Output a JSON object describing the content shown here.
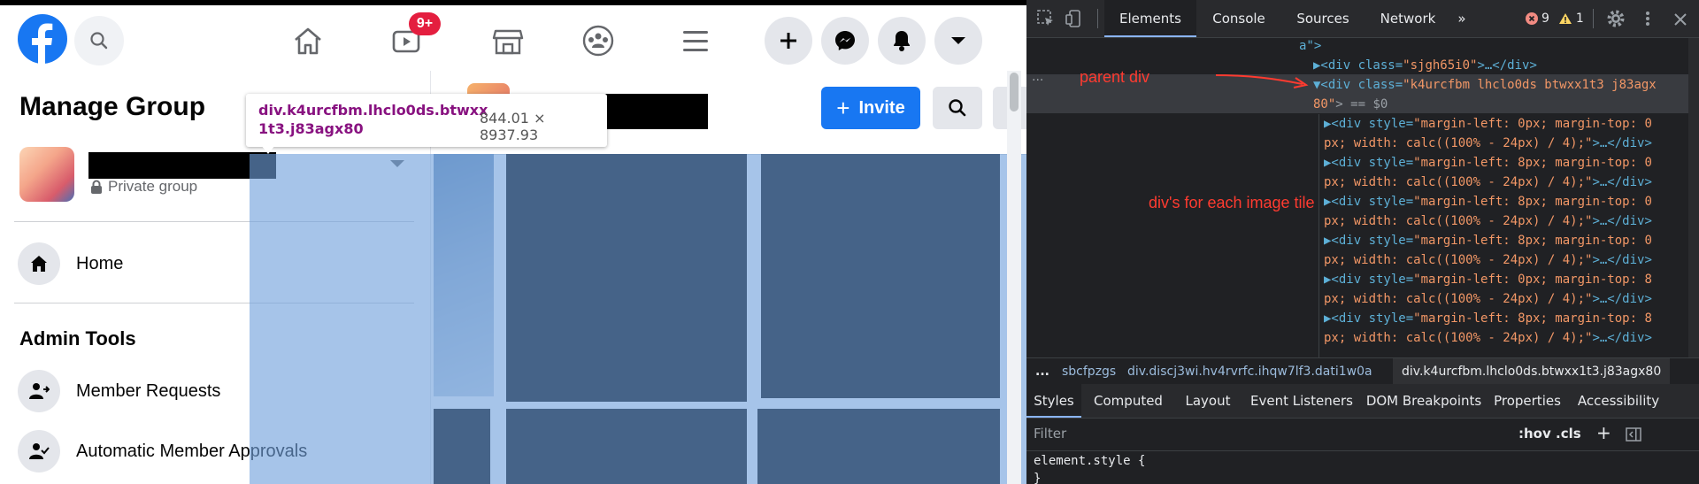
{
  "facebook": {
    "topbar": {
      "search_icon": "search-icon",
      "notifications_badge": "9+",
      "nav_icons": [
        "home-icon",
        "watch-icon",
        "marketplace-icon",
        "groups-icon",
        "menu-icon"
      ],
      "actions": [
        "create-icon",
        "messenger-icon",
        "notifications-icon",
        "account-dropdown-icon"
      ]
    },
    "sidebar": {
      "title": "Manage Group",
      "group_privacy": "Private group",
      "nav_home": "Home",
      "section_admin": "Admin Tools",
      "admin_items": [
        "Member Requests",
        "Automatic Member Approvals"
      ]
    },
    "header": {
      "invite_label": "Invite",
      "invite_icon": "+"
    },
    "tooltip": {
      "selector_line1": "div.k4urcfbm.lhclo0ds.btwxx",
      "selector_line2": "1t3.j83agx80",
      "dimensions": "844.01 × 8937.93"
    }
  },
  "devtools": {
    "tabs": [
      "Elements",
      "Console",
      "Sources",
      "Network",
      "»"
    ],
    "active_tab": "Elements",
    "error_count": "9",
    "warning_count": "1",
    "code_lines": {
      "l0": "a\">",
      "l1_prefix": "▶<div class=",
      "l1_val": "\"sjgh65i0\"",
      "l1_suffix": ">…</div>",
      "l2_prefix": "▼<div class=",
      "l2_val": "\"k4urcfbm lhclo0ds btwxx1t3 j83agx",
      "l3_val": "80\"",
      "l3_suffix": "> == $0",
      "child_a1": "▶<div style=",
      "child_a1_val": "\"margin-left: 0px; margin-top: 0",
      "child_a2_val": "px; width: calc((100% - 24px) / 4);\"",
      "child_a2_suffix": ">…</div>",
      "child_b1_val": "\"margin-left: 8px; margin-top: 0",
      "child_c1_val": "\"margin-left: 8px; margin-top: 0",
      "child_d1_val": "\"margin-left: 8px; margin-top: 0",
      "child_e1_val": "\"margin-left: 0px; margin-top: 8",
      "child_f1_val": "\"margin-left: 8px; margin-top: 8",
      "child_f2_val": "px; width: calc((100% - 24px) / 4);\"",
      "child_g1_val": "\"margin-left: 8px; margin-top: 8"
    },
    "annotations": {
      "parent": "parent div",
      "children": "div's for each image tile"
    },
    "breadcrumbs": [
      "...",
      "sbcfpzgs",
      "div.discj3wi.hv4rvrfc.ihqw7lf3.dati1w0a",
      "div.k4urcfbm.lhclo0ds.btwxx1t3.j83agx80"
    ],
    "subtabs": [
      "Styles",
      "Computed",
      "Layout",
      "Event Listeners",
      "DOM Breakpoints",
      "Properties",
      "Accessibility"
    ],
    "active_subtab": "Styles",
    "filter_placeholder": "Filter",
    "filter_buttons": [
      ":hov",
      ".cls",
      "+"
    ],
    "styles": {
      "rule_open": "element.style {",
      "rule_close": "}"
    },
    "colors": {
      "annotation_red": "#ff3b30",
      "accent_blue": "#8ab4f8"
    }
  },
  "colors": {
    "fb_blue": "#1877f2",
    "badge_red": "#e41e3f",
    "highlight_overlay": "#6fa0dc"
  }
}
